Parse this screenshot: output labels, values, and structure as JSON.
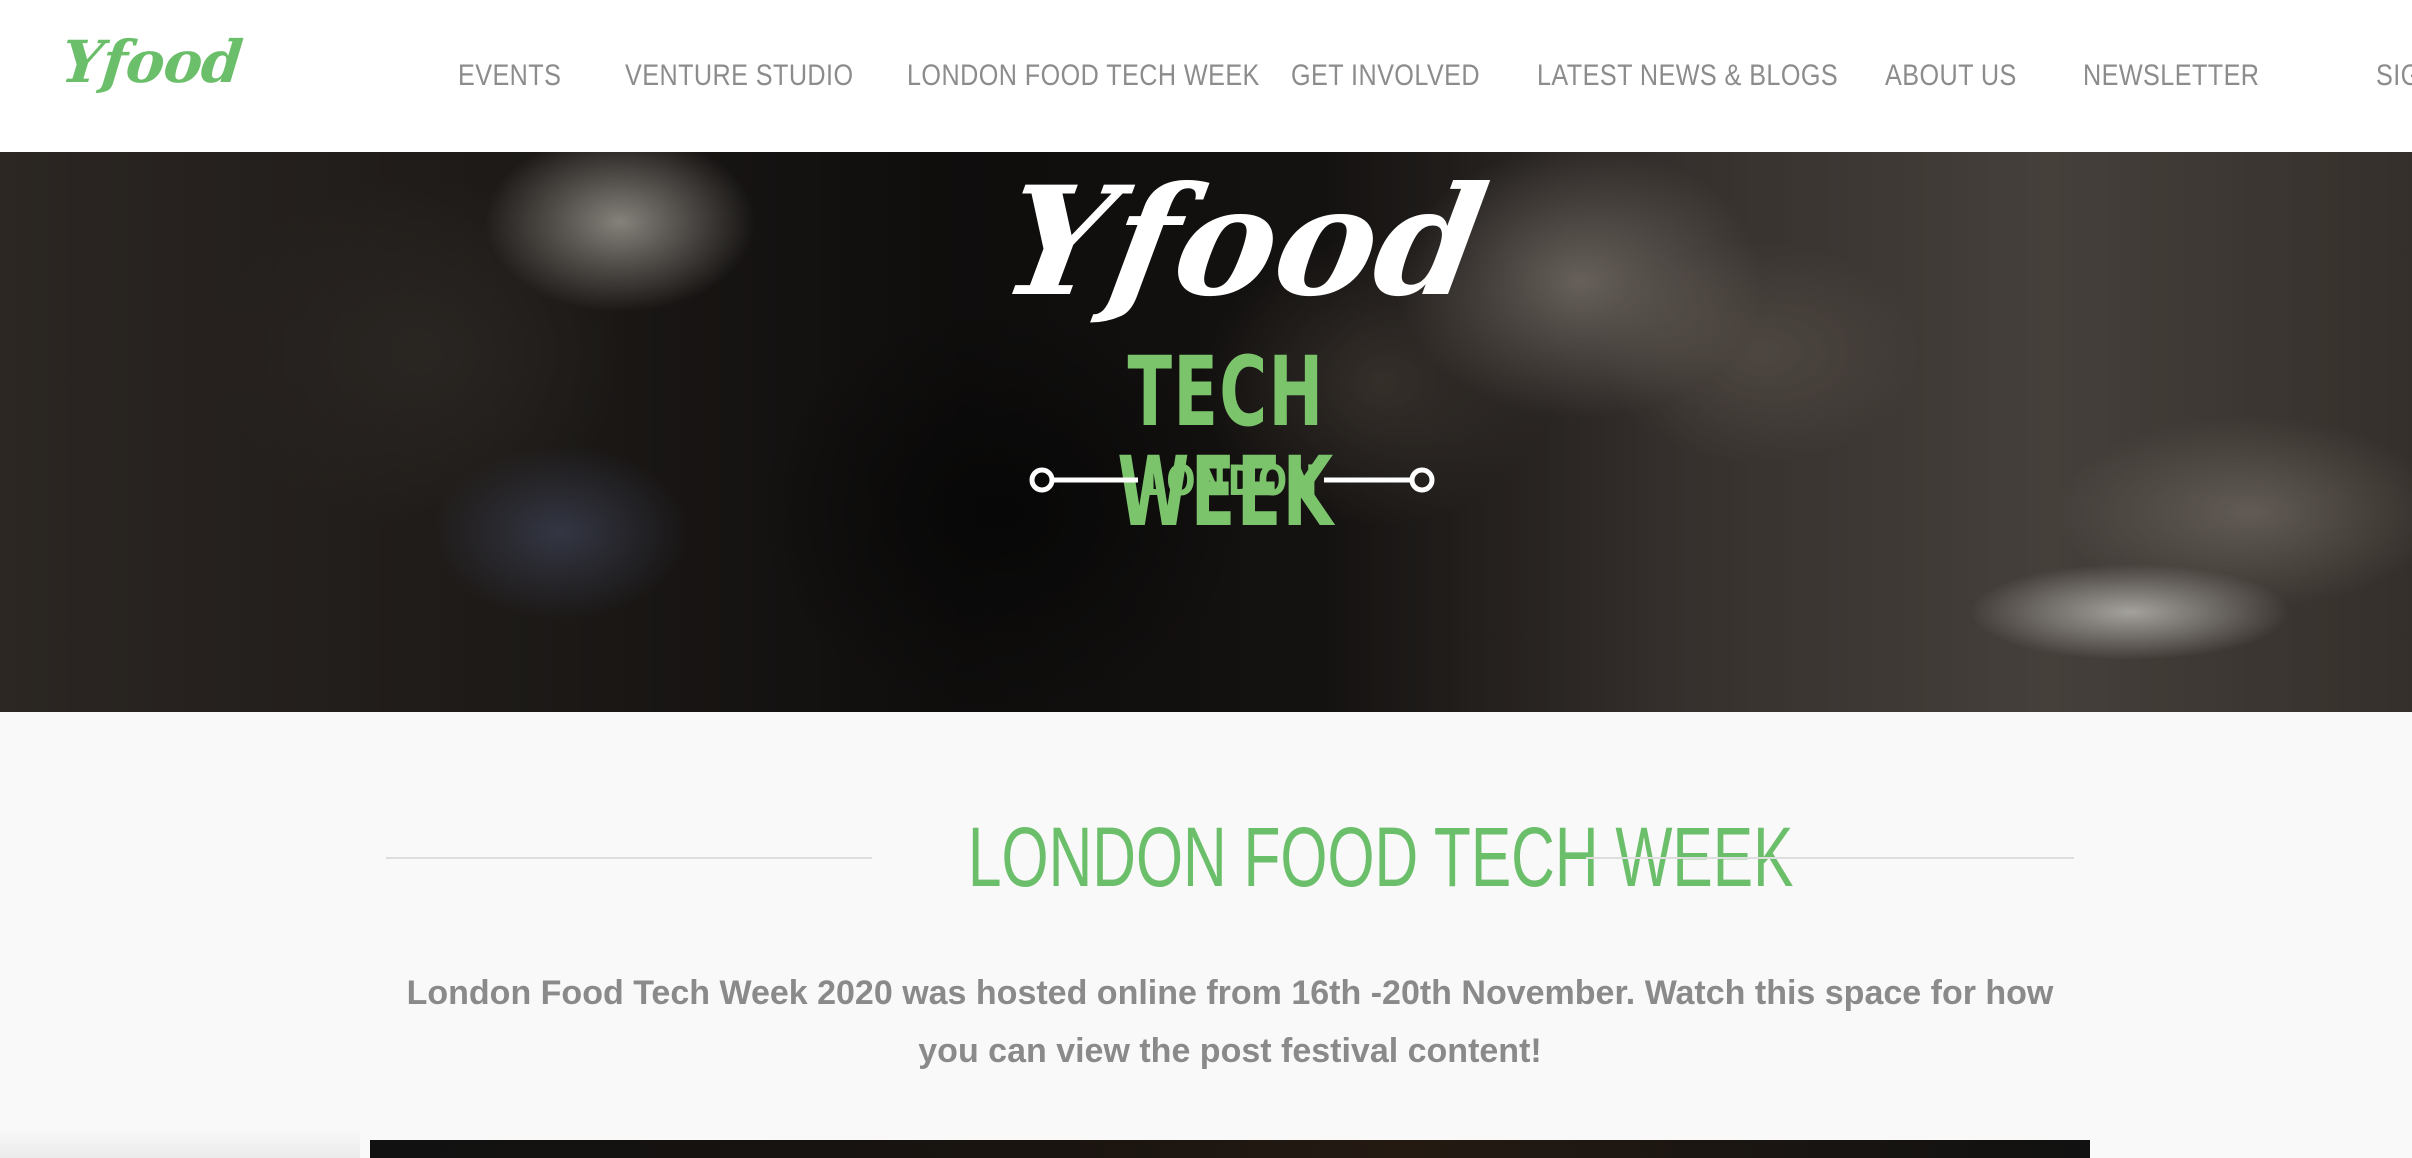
{
  "header": {
    "logo_text": "Yfood",
    "nav": [
      {
        "label": "EVENTS"
      },
      {
        "label": "VENTURE STUDIO"
      },
      {
        "label": "LONDON FOOD TECH WEEK"
      },
      {
        "label": "GET INVOLVED"
      },
      {
        "label": "LATEST NEWS & BLOGS"
      },
      {
        "label": "ABOUT US"
      },
      {
        "label": "NEWSLETTER"
      },
      {
        "label": "SIG"
      }
    ]
  },
  "hero": {
    "script_text": "Yfood",
    "tech_week_text": "TECH WEEK",
    "city_text": "LONDON"
  },
  "content": {
    "heading": "LONDON FOOD TECH WEEK",
    "intro": "London Food Tech Week 2020 was hosted online from 16th -20th November. Watch this space for how you can view the post festival content!"
  },
  "colors": {
    "brand_green": "#6cbf6a",
    "nav_grey": "#8c8c8c",
    "body_text_grey": "#8a8a8a"
  }
}
